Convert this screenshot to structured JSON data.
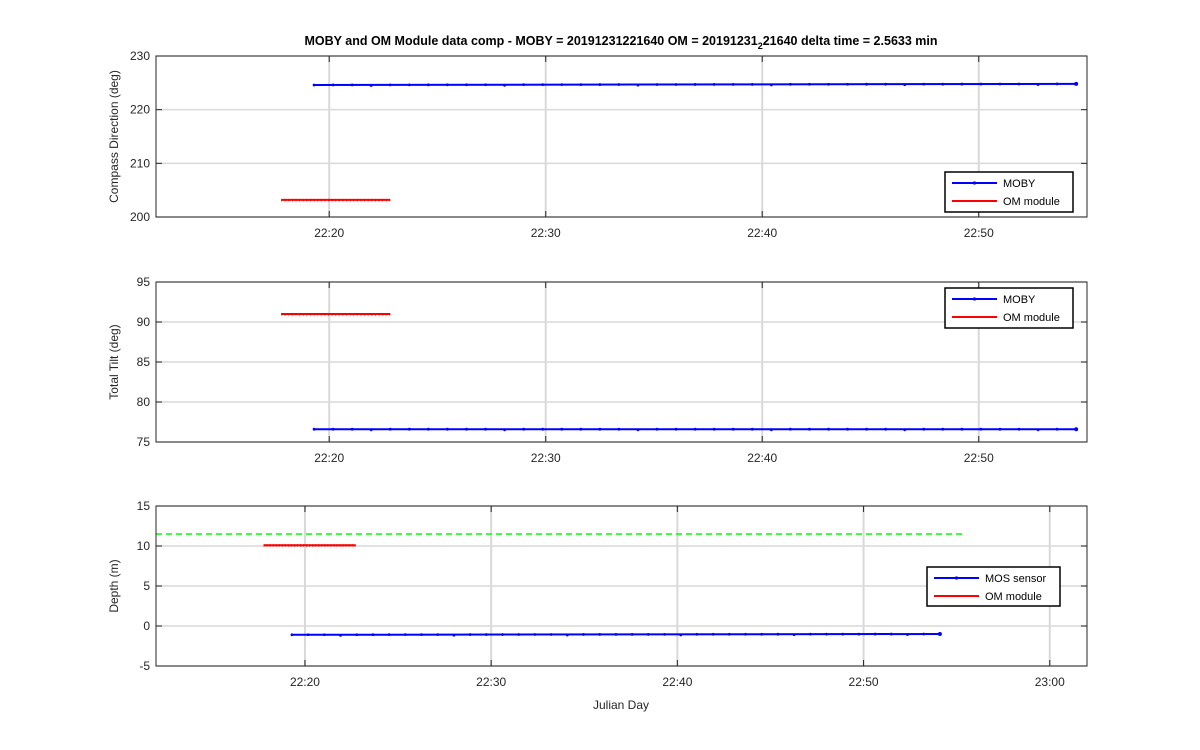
{
  "figure": {
    "title_main": "MOBY and OM Module data comp - MOBY = 20191231221640 OM = 20191231",
    "title_subscript": "2",
    "title_tail": "21640 delta time = 2.5633 min",
    "xlabel": "Julian Day"
  },
  "colors": {
    "moby": "#0000ff",
    "om": "#ff0000",
    "reference": "#00ff00",
    "grid": "#d9d9d9",
    "axis": "#262626"
  },
  "chart_data": [
    {
      "type": "line",
      "ylabel": "Compass Direction (deg)",
      "xlim": [
        "22:12",
        "22:55"
      ],
      "ylim": [
        200,
        230
      ],
      "xticks": [
        "22:20",
        "22:30",
        "22:40",
        "22:50"
      ],
      "yticks": [
        200,
        210,
        220,
        230
      ],
      "grid": "vertical",
      "legend_position": "bottom-right",
      "series": [
        {
          "name": "MOBY",
          "color": "#0000ff",
          "x": [
            "22:19.3",
            "22:54.5"
          ],
          "y": [
            224.6,
            224.8
          ]
        },
        {
          "name": "OM module",
          "color": "#ff0000",
          "x": [
            "22:17.8",
            "22:22.8"
          ],
          "y": [
            203.2,
            203.2
          ]
        }
      ]
    },
    {
      "type": "line",
      "ylabel": "Total Tilt (deg)",
      "xlim": [
        "22:12",
        "22:55"
      ],
      "ylim": [
        75,
        95
      ],
      "xticks": [
        "22:20",
        "22:30",
        "22:40",
        "22:50"
      ],
      "yticks": [
        75,
        80,
        85,
        90,
        95
      ],
      "grid": "vertical",
      "legend_position": "top-right",
      "series": [
        {
          "name": "MOBY",
          "color": "#0000ff",
          "x": [
            "22:19.3",
            "22:54.5"
          ],
          "y": [
            76.6,
            76.6
          ]
        },
        {
          "name": "OM module",
          "color": "#ff0000",
          "x": [
            "22:17.8",
            "22:22.8"
          ],
          "y": [
            91.0,
            91.0
          ]
        }
      ]
    },
    {
      "type": "line",
      "ylabel": "Depth (m)",
      "xlim": [
        "22:12",
        "23:02"
      ],
      "ylim": [
        -5,
        15
      ],
      "xticks": [
        "22:20",
        "22:30",
        "22:40",
        "22:50",
        "23:00"
      ],
      "yticks": [
        -5,
        0,
        5,
        10,
        15
      ],
      "grid": "vertical",
      "legend_position": "right",
      "series": [
        {
          "name": "MOS sensor",
          "color": "#0000ff",
          "x": [
            "22:19.3",
            "22:54.1"
          ],
          "y": [
            -1.1,
            -1.0
          ]
        },
        {
          "name": "OM module",
          "color": "#ff0000",
          "x": [
            "22:17.8",
            "22:22.7"
          ],
          "y": [
            10.1,
            10.1
          ]
        },
        {
          "color": "#00ff00",
          "style": "dashed",
          "x": [
            "22:12",
            "22:55.5"
          ],
          "y": [
            11.5,
            11.5
          ]
        }
      ]
    }
  ]
}
